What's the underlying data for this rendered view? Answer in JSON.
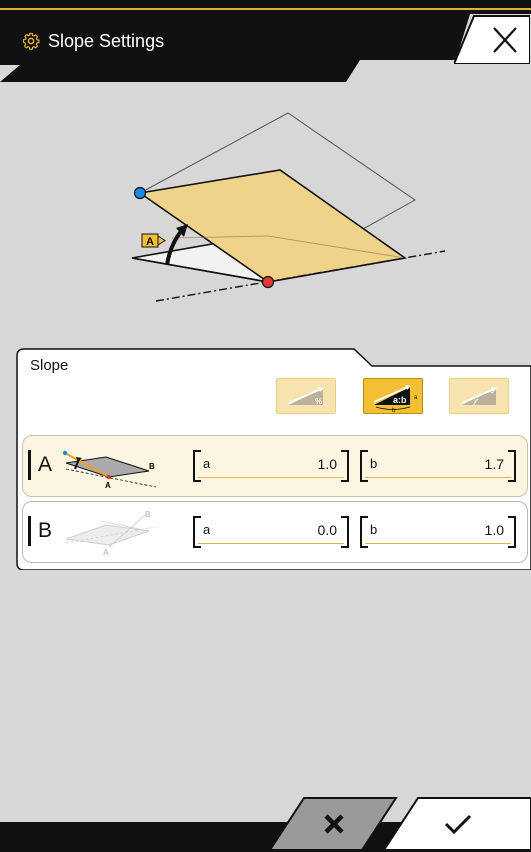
{
  "header": {
    "title": "Slope Settings",
    "icon": "gear-icon",
    "close_icon": "close-icon"
  },
  "illustration": {
    "angle_label": "A"
  },
  "slope_panel": {
    "title": "Slope",
    "modes": [
      {
        "name": "percent",
        "icon_text": "%",
        "selected": false
      },
      {
        "name": "ratio",
        "icon_text": "a:b",
        "selected": true
      },
      {
        "name": "degree",
        "icon_text": "°",
        "selected": false
      }
    ],
    "rows": [
      {
        "letter": "A",
        "a_label": "a",
        "a_value": "1.0",
        "b_label": "b",
        "b_value": "1.7",
        "selected": true
      },
      {
        "letter": "B",
        "a_label": "a",
        "a_value": "0.0",
        "b_label": "b",
        "b_value": "1.0",
        "selected": false
      }
    ]
  },
  "footer": {
    "cancel_icon": "x-icon",
    "ok_icon": "check-icon"
  },
  "colors": {
    "accent": "#f3bf34",
    "plane_fill": "#f0d38a",
    "header_bg": "#111111",
    "point_blue": "#1e88e5",
    "point_red": "#e53935"
  }
}
